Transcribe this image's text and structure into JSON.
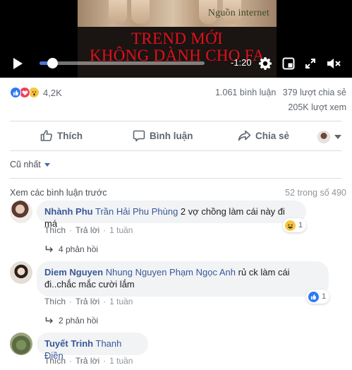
{
  "video": {
    "watermark": "Nguồn internet",
    "title_line1": "TREND MỚI",
    "title_line2": "KHÔNG DÀNH CHO FA",
    "time_remaining": "-1:20",
    "progress_percent": 7
  },
  "stats": {
    "reactions_count": "4,2K",
    "comments": "1.061 bình luận",
    "shares": "379 lượt chia sẻ",
    "views": "205K lượt xem"
  },
  "actions": {
    "like": "Thích",
    "comment": "Bình luận",
    "share": "Chia sẻ"
  },
  "sort": {
    "label": "Cũ nhất"
  },
  "comments_header": {
    "prev_link": "Xem các bình luận trước",
    "count": "52 trong số 490"
  },
  "comments": [
    {
      "author": "Nhành Phu",
      "tag": "Trần Hải Phu Phùng",
      "text": " 2 vợ chồng làm cái này đi má",
      "reaction_count": "1",
      "reaction_type": "haha",
      "like": "Thích",
      "reply": "Trả lời",
      "age": "1 tuần",
      "replies": "4 phản hồi"
    },
    {
      "author": "Diem Nguyen",
      "tag": "Nhung Nguyen Phạm Ngọc Anh",
      "text": " rủ ck làm cái đi..chắc mắc cười lắm",
      "reaction_count": "1",
      "reaction_type": "like",
      "like": "Thích",
      "reply": "Trả lời",
      "age": "1 tuần",
      "replies": "2 phản hồi"
    },
    {
      "author": "Tuyết Trinh",
      "tag": "Thanh Điền",
      "text": "",
      "like": "Thích",
      "reply": "Trả lời",
      "age": "1 tuần"
    }
  ],
  "colors": {
    "link": "#385898",
    "accent_blue": "#4267b2",
    "bubble": "#f2f3f5",
    "scrub_fill": "#4a76d6",
    "video_text": "#e0101a"
  }
}
